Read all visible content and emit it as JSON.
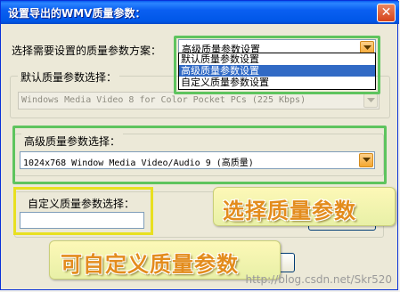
{
  "window": {
    "title": "设置导出的WMV质量参数：",
    "close_glyph": "✕"
  },
  "scheme": {
    "label": "选择需要设置的质量参数方案：",
    "selected": "高级质量参数设置",
    "options": [
      "默认质量参数设置",
      "高级质量参数设置",
      "自定义质量参数设置"
    ],
    "highlighted_option": "高级质量参数设置"
  },
  "default_group": {
    "title": "默认质量参数选择：",
    "value": "Windows Media Video 8 for Color Pocket PCs (225 Kbps)",
    "enabled": false
  },
  "advanced_group": {
    "title": "高级质量参数选择：",
    "value": "1024x768 Window Media Video/Audio 9 (高质量)"
  },
  "custom_group": {
    "title": "自定义质量参数选择："
  },
  "annotations": {
    "choose_quality": "选择质量参数",
    "custom_quality": "可自定义质量参数"
  },
  "watermark": "http://blog.csdn.net/Skr520",
  "colors": {
    "highlight_green": "#5ec45e",
    "highlight_yellow": "#e8e020",
    "selection_blue": "#316ac5",
    "title_bar": "#0a5ff1"
  }
}
